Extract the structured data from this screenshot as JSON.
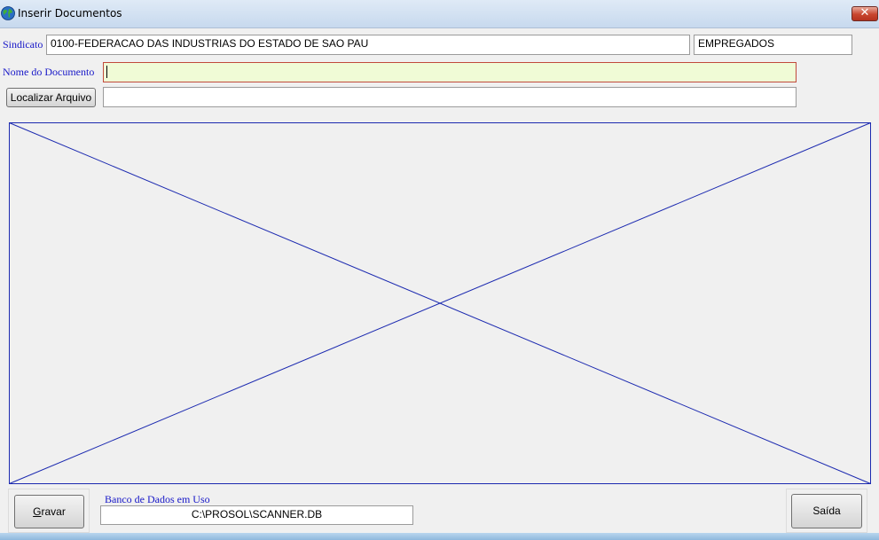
{
  "window": {
    "title": "Inserir Documentos",
    "close_label": "✕"
  },
  "form": {
    "sindicato_label": "Sindicato",
    "sindicato_value": "0100-FEDERACAO DAS INDUSTRIAS DO ESTADO DE SAO PAU",
    "categoria_value": "EMPREGADOS",
    "nome_documento_label": "Nome do Documento",
    "nome_documento_value": "",
    "localizar_button": "Localizar Arquivo",
    "arquivo_path_value": ""
  },
  "footer": {
    "gravar_button": "Gravar",
    "gravar_underlined": "G",
    "gravar_rest": "ravar",
    "banco_label": "Banco de Dados em Uso",
    "banco_value": "C:\\PROSOL\\SCANNER.DB",
    "saida_button": "Saída"
  },
  "colors": {
    "label_blue": "#1818c8",
    "preview_border": "#1c2ab0",
    "focus_background": "#f0fbd6"
  },
  "icons": {
    "app": "globe-icon",
    "close": "close-icon"
  }
}
